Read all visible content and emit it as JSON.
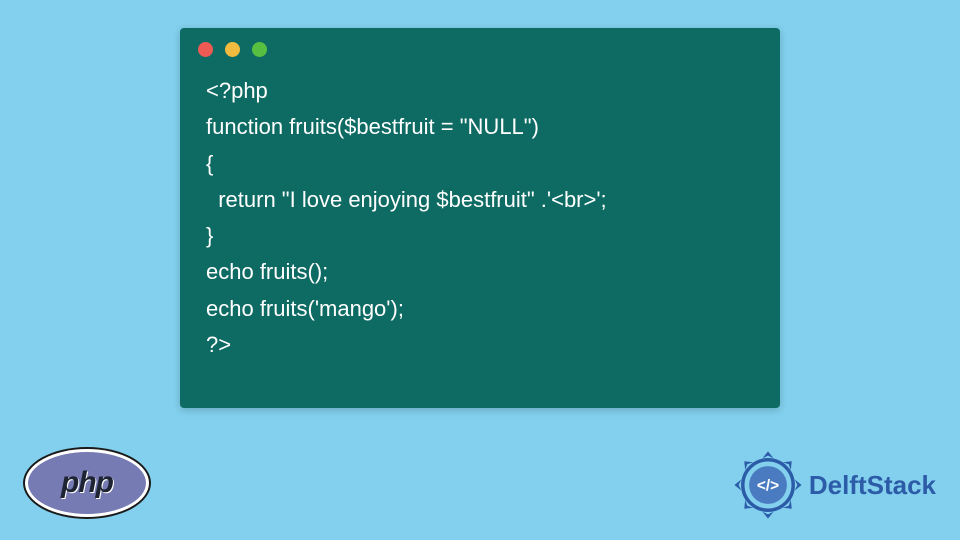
{
  "code": {
    "line1": "<?php",
    "line2": "function fruits($bestfruit = \"NULL\")",
    "line3": "{",
    "line4": "  return \"I love enjoying $bestfruit\" .'<br>';",
    "line5": "}",
    "line6": "echo fruits();",
    "line7": "echo fruits('mango');",
    "line8": "?>"
  },
  "logos": {
    "php": "php",
    "delftstack": "DelftStack"
  }
}
